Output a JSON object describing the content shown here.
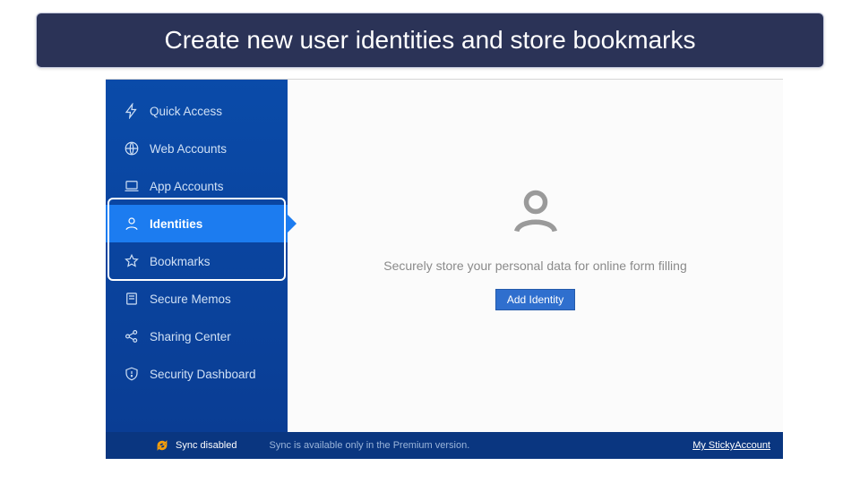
{
  "banner": {
    "title": "Create new user identities and store bookmarks"
  },
  "sidebar": {
    "items": [
      {
        "label": "Quick Access",
        "icon": "bolt-icon",
        "active": false
      },
      {
        "label": "Web Accounts",
        "icon": "globe-icon",
        "active": false
      },
      {
        "label": "App Accounts",
        "icon": "laptop-icon",
        "active": false
      },
      {
        "label": "Identities",
        "icon": "person-icon",
        "active": true
      },
      {
        "label": "Bookmarks",
        "icon": "star-icon",
        "active": false
      },
      {
        "label": "Secure Memos",
        "icon": "note-icon",
        "active": false
      },
      {
        "label": "Sharing Center",
        "icon": "share-icon",
        "active": false
      },
      {
        "label": "Security Dashboard",
        "icon": "shield-icon",
        "active": false
      }
    ]
  },
  "main": {
    "empty_message": "Securely store your personal data for online form filling",
    "add_button": "Add Identity"
  },
  "footer": {
    "sync_status": "Sync disabled",
    "premium_note": "Sync is available only in the Premium version.",
    "account_link": "My StickyAccount"
  },
  "colors": {
    "banner_bg": "#2b3357",
    "sidebar_bg": "#0a4ba9",
    "active_bg": "#1c7cf0",
    "button_bg": "#2f6fce"
  }
}
